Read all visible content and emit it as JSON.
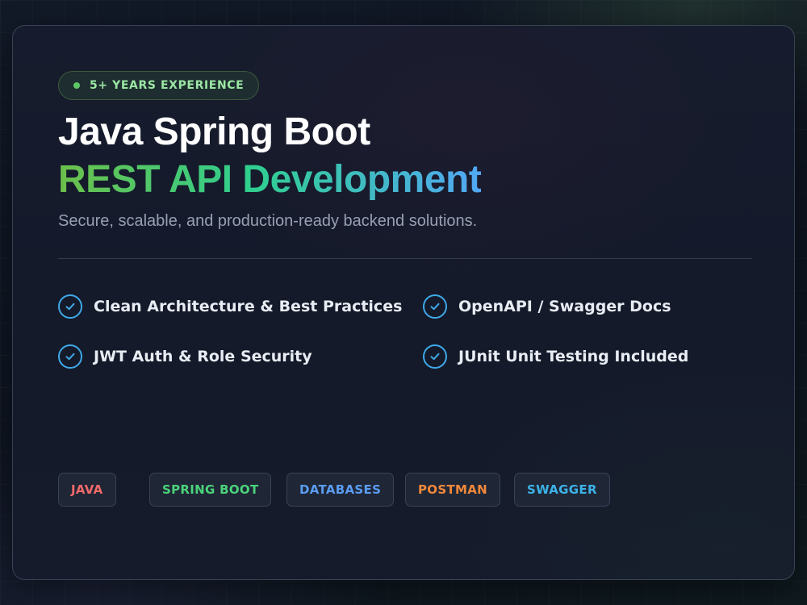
{
  "badge": {
    "label": "5+ YEARS EXPERIENCE"
  },
  "heading": {
    "line1": "Java Spring Boot",
    "line2": "REST API Development"
  },
  "subtitle": "Secure, scalable, and production-ready backend solutions.",
  "features": [
    {
      "label": "Clean Architecture & Best Practices"
    },
    {
      "label": "OpenAPI / Swagger Docs"
    },
    {
      "label": "JWT Auth & Role Security"
    },
    {
      "label": "JUnit Unit Testing Included"
    }
  ],
  "tags": [
    {
      "label": "JAVA",
      "color": "#f06a6a"
    },
    {
      "label": "SPRING BOOT",
      "color": "#4bd37b"
    },
    {
      "label": "DATABASES",
      "color": "#5b9cf0"
    },
    {
      "label": "POSTMAN",
      "color": "#f2883a"
    },
    {
      "label": "SWAGGER",
      "color": "#3cb3e8"
    }
  ],
  "colors": {
    "accent_check": "#3fa9e8",
    "badge_text": "#9be6a3"
  },
  "icons": {
    "feature_check": "check-circle-icon",
    "badge_dot": "status-dot-icon"
  }
}
